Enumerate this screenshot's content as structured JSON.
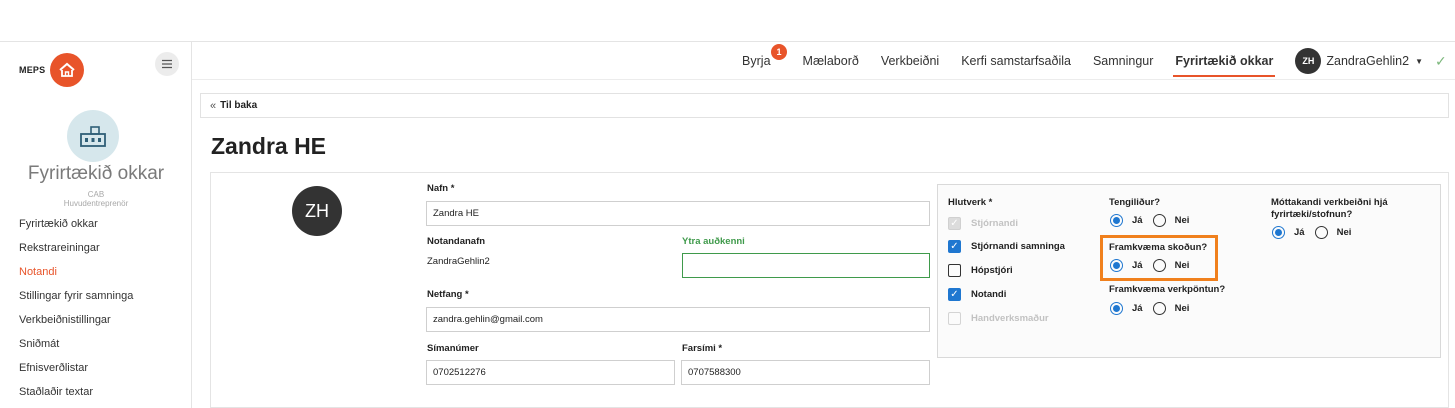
{
  "app": {
    "logo_text": "MEPS"
  },
  "sidebar": {
    "company_title": "Fyrirtækið okkar",
    "company_code": "CAB",
    "company_type": "Huvudentreprenör",
    "items": [
      {
        "label": "Fyrirtækið okkar"
      },
      {
        "label": "Rekstrareiningar"
      },
      {
        "label": "Notandi"
      },
      {
        "label": "Stillingar fyrir samninga"
      },
      {
        "label": "Verkbeiðnistillingar"
      },
      {
        "label": "Sniðmát"
      },
      {
        "label": "Efnisverðlistar"
      },
      {
        "label": "Staðlaðir textar"
      }
    ],
    "active_index": 2
  },
  "topnav": {
    "items": [
      {
        "label": "Byrja",
        "badge": "1"
      },
      {
        "label": "Mælaborð"
      },
      {
        "label": "Verkbeiðni"
      },
      {
        "label": "Kerfi samstarfsaðila"
      },
      {
        "label": "Samningur"
      },
      {
        "label": "Fyrirtækið okkar",
        "active": true
      }
    ],
    "user_initials": "ZH",
    "user_name": "ZandraGehlin2"
  },
  "back": {
    "label": "Til baka"
  },
  "page": {
    "title": "Zandra HE",
    "avatar_initials": "ZH"
  },
  "form": {
    "name_label": "Nafn *",
    "name_value": "Zandra HE",
    "username_label": "Notandanafn",
    "username_value": "ZandraGehlin2",
    "external_id_label": "Ytra auðkenni",
    "external_id_value": "",
    "email_label": "Netfang *",
    "email_value": "zandra.gehlin@gmail.com",
    "phone_label": "Símanúmer",
    "phone_value": "0702512276",
    "mobile_label": "Farsími *",
    "mobile_value": "0707588300"
  },
  "roles": {
    "title": "Hlutverk *",
    "items": [
      {
        "label": "Stjórnandi",
        "checked": true,
        "disabled": true
      },
      {
        "label": "Stjórnandi samninga",
        "checked": true,
        "disabled": false
      },
      {
        "label": "Hópstjóri",
        "checked": false,
        "disabled": false
      },
      {
        "label": "Notandi",
        "checked": true,
        "disabled": false
      },
      {
        "label": "Handverksmaður",
        "checked": false,
        "disabled": true
      }
    ]
  },
  "questions": {
    "contact_label": "Tengiliður?",
    "inspect_label": "Framkvæma skoðun?",
    "order_label": "Framkvæma verkpöntun?",
    "receiver_label_1": "Móttakandi verkbeiðni hjá",
    "receiver_label_2": "fyrirtæki/stofnun?",
    "yes": "Já",
    "no": "Nei",
    "contact_value": "yes",
    "inspect_value": "yes",
    "order_value": "yes",
    "receiver_value": "yes"
  },
  "colors": {
    "accent": "#e8542a",
    "checkbox": "#1f77d0",
    "highlight": "#f0801d",
    "green": "#3f9a4b"
  }
}
